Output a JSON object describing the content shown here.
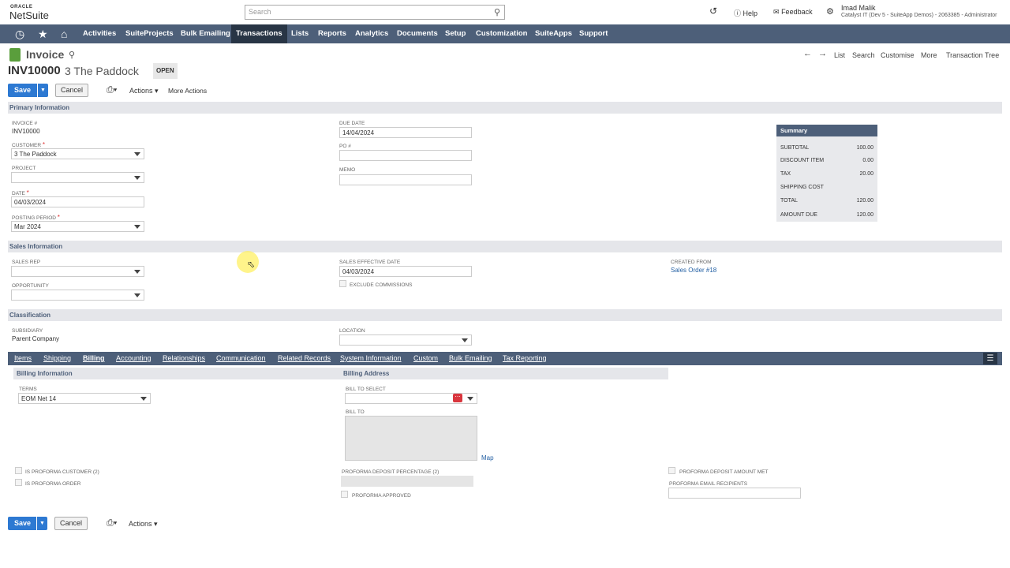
{
  "brand": {
    "oracle": "ORACLE",
    "netsuite": "NetSuite"
  },
  "search": {
    "placeholder": "Search"
  },
  "topbar": {
    "help": "Help",
    "feedback": "Feedback",
    "user_name": "Imad Malik",
    "account": "Catalyst IT (Dev 5 - SuiteApp Demos) - 2063385 - Administrator"
  },
  "nav": [
    "Activities",
    "SuiteProjects",
    "Bulk Emailing",
    "Transactions",
    "Lists",
    "Reports",
    "Analytics",
    "Documents",
    "Setup",
    "Customization",
    "SuiteApps",
    "Support"
  ],
  "nav_active": "Transactions",
  "page": {
    "title": "Invoice",
    "record_id": "INV10000",
    "record_name": "3 The Paddock",
    "status": "OPEN"
  },
  "record_links": [
    "List",
    "Search",
    "Customise",
    "More",
    "Transaction Tree"
  ],
  "buttons": {
    "save": "Save",
    "cancel": "Cancel",
    "actions": "Actions",
    "more_actions": "More Actions"
  },
  "sections": {
    "primary": "Primary Information",
    "sales": "Sales Information",
    "classification": "Classification"
  },
  "primary": {
    "invoice_label": "INVOICE #",
    "invoice_value": "INV10000",
    "customer_label": "CUSTOMER",
    "customer_value": "3 The Paddock",
    "project_label": "PROJECT",
    "project_value": "",
    "date_label": "DATE",
    "date_value": "04/03/2024",
    "period_label": "POSTING PERIOD",
    "period_value": "Mar 2024",
    "due_label": "DUE DATE",
    "due_value": "14/04/2024",
    "po_label": "PO #",
    "po_value": "",
    "memo_label": "MEMO",
    "memo_value": ""
  },
  "summary": {
    "title": "Summary",
    "rows": [
      {
        "label": "SUBTOTAL",
        "value": "100.00"
      },
      {
        "label": "DISCOUNT ITEM",
        "value": "0.00"
      },
      {
        "label": "TAX",
        "value": "20.00"
      },
      {
        "label": "SHIPPING COST",
        "value": ""
      },
      {
        "label": "TOTAL",
        "value": "120.00"
      },
      {
        "label": "AMOUNT DUE",
        "value": "120.00"
      }
    ]
  },
  "sales": {
    "rep_label": "SALES REP",
    "opportunity_label": "OPPORTUNITY",
    "effective_label": "SALES EFFECTIVE DATE",
    "effective_value": "04/03/2024",
    "exclude_label": "EXCLUDE COMMISSIONS",
    "created_label": "CREATED FROM",
    "created_value": "Sales Order #18"
  },
  "classification": {
    "subsidiary_label": "SUBSIDIARY",
    "subsidiary_value": "Parent Company",
    "location_label": "LOCATION"
  },
  "subtabs": [
    "Items",
    "Shipping",
    "Billing",
    "Accounting",
    "Relationships",
    "Communication",
    "Related Records",
    "System Information",
    "Custom",
    "Bulk Emailing",
    "Tax Reporting"
  ],
  "subtab_active": "Billing",
  "billing": {
    "info_hdr": "Billing Information",
    "address_hdr": "Billing Address",
    "terms_label": "TERMS",
    "terms_value": "EOM Net 14",
    "bill_to_select_label": "BILL TO SELECT",
    "bill_to_label": "BILL TO",
    "map": "Map",
    "proforma_customer": "IS PROFORMA CUSTOMER (2)",
    "proforma_order": "IS PROFORMA ORDER",
    "deposit_pct": "PROFORMA DEPOSIT PERCENTAGE (2)",
    "approved": "PROFORMA APPROVED",
    "deposit_met": "PROFORMA DEPOSIT AMOUNT MET",
    "email_recipients": "PROFORMA EMAIL RECIPIENTS"
  }
}
